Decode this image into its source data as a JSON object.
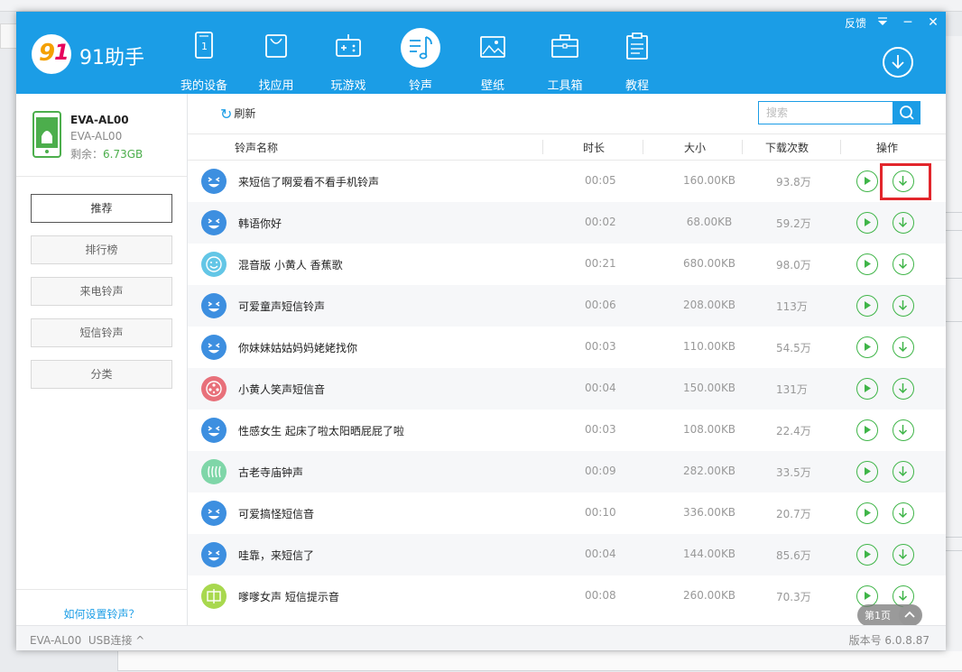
{
  "app": {
    "brand": "91助手",
    "feedback": "反馈",
    "window_controls": {
      "menu_icon": "triangle-down-icon",
      "minimize": "─",
      "close": "✕"
    }
  },
  "nav": [
    {
      "label": "我的设备",
      "icon": "device-icon",
      "active": false
    },
    {
      "label": "找应用",
      "icon": "shopping-bag-icon",
      "active": false
    },
    {
      "label": "玩游戏",
      "icon": "gamepad-icon",
      "active": false
    },
    {
      "label": "铃声",
      "icon": "music-note-icon",
      "active": true
    },
    {
      "label": "壁纸",
      "icon": "picture-icon",
      "active": false
    },
    {
      "label": "工具箱",
      "icon": "toolbox-icon",
      "active": false
    },
    {
      "label": "教程",
      "icon": "clipboard-icon",
      "active": false
    }
  ],
  "device": {
    "name": "EVA-AL00",
    "model": "EVA-AL00",
    "free_label": "剩余：",
    "free_value": "6.73GB"
  },
  "categories": [
    {
      "label": "推荐",
      "active": true
    },
    {
      "label": "排行榜",
      "active": false
    },
    {
      "label": "来电铃声",
      "active": false
    },
    {
      "label": "短信铃声",
      "active": false
    },
    {
      "label": "分类",
      "active": false
    }
  ],
  "sidebar": {
    "help_link": "如何设置铃声？"
  },
  "toolbar": {
    "refresh": "刷新",
    "search_placeholder": "搜索"
  },
  "table": {
    "headers": {
      "name": "铃声名称",
      "duration": "时长",
      "size": "大小",
      "downloads": "下载次数",
      "actions": "操作"
    },
    "rows": [
      {
        "name": "来短信了啊爱看不看手机铃声",
        "duration": "00:05",
        "size": "160.00KB",
        "downloads": "93.8万",
        "avatar_color": "#3d8fe0",
        "icon": "laughing-face-icon"
      },
      {
        "name": "韩语你好",
        "duration": "00:02",
        "size": "68.00KB",
        "downloads": "59.2万",
        "avatar_color": "#3d8fe0",
        "icon": "laughing-face-icon"
      },
      {
        "name": "混音版 小黄人  香蕉歌",
        "duration": "00:21",
        "size": "680.00KB",
        "downloads": "98.0万",
        "avatar_color": "#63c6e6",
        "icon": "smile-face-icon"
      },
      {
        "name": "可爱童声短信铃声",
        "duration": "00:06",
        "size": "208.00KB",
        "downloads": "113万",
        "avatar_color": "#3d8fe0",
        "icon": "laughing-face-icon"
      },
      {
        "name": "你妹妹姑姑妈妈姥姥找你",
        "duration": "00:03",
        "size": "110.00KB",
        "downloads": "54.5万",
        "avatar_color": "#3d8fe0",
        "icon": "laughing-face-icon"
      },
      {
        "name": "小黄人笑声短信音",
        "duration": "00:04",
        "size": "150.00KB",
        "downloads": "131万",
        "avatar_color": "#e8707a",
        "icon": "film-reel-icon"
      },
      {
        "name": "性感女生 起床了啦太阳晒屁屁了啦",
        "duration": "00:03",
        "size": "108.00KB",
        "downloads": "22.4万",
        "avatar_color": "#3d8fe0",
        "icon": "laughing-face-icon"
      },
      {
        "name": "古老寺庙钟声",
        "duration": "00:09",
        "size": "282.00KB",
        "downloads": "33.5万",
        "avatar_color": "#7fd6a8",
        "icon": "bells-icon"
      },
      {
        "name": "可爱搞怪短信音",
        "duration": "00:10",
        "size": "336.00KB",
        "downloads": "20.7万",
        "avatar_color": "#3d8fe0",
        "icon": "laughing-face-icon"
      },
      {
        "name": "哇靠，来短信了",
        "duration": "00:04",
        "size": "144.00KB",
        "downloads": "85.6万",
        "avatar_color": "#3d8fe0",
        "icon": "laughing-face-icon"
      },
      {
        "name": "嗲嗲女声 短信提示音",
        "duration": "00:08",
        "size": "260.00KB",
        "downloads": "70.3万",
        "avatar_color": "#a8d84e",
        "icon": "chinese-char-icon"
      }
    ]
  },
  "pager": {
    "label": "第1页"
  },
  "status": {
    "device": "EVA-AL00",
    "connection": "USB连接 ^",
    "version": "版本号 6.0.8.87"
  }
}
